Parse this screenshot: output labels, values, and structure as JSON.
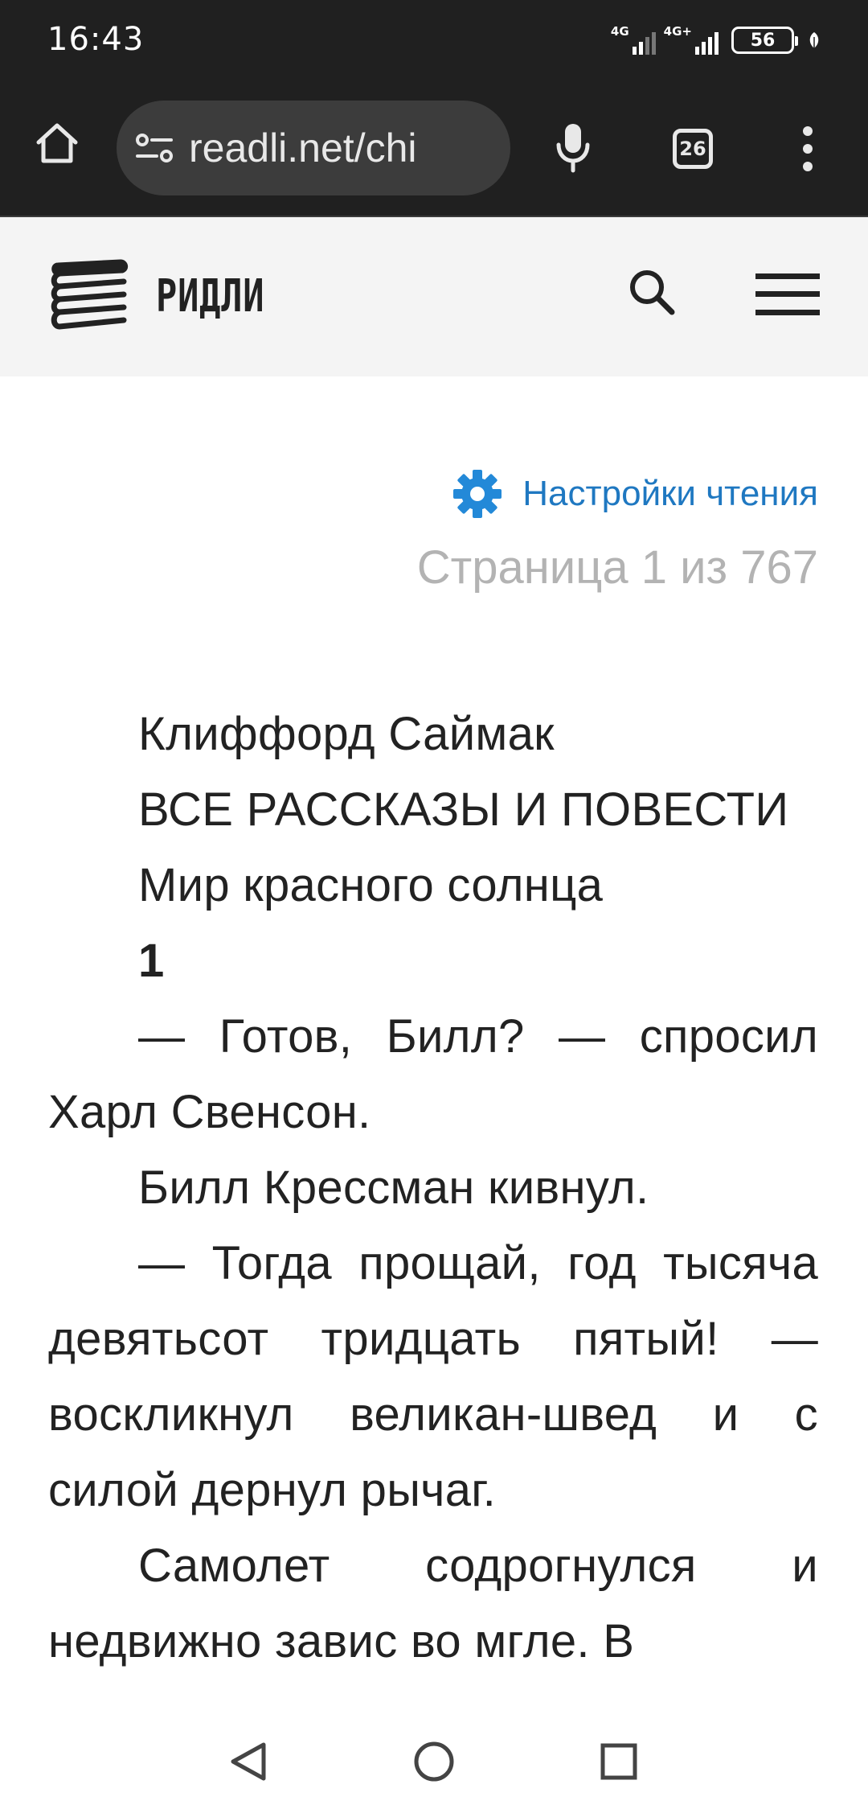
{
  "status_bar": {
    "time": "16:43",
    "network1": "4G",
    "network2": "4G+",
    "battery": "56",
    "icons": [
      "signal-4g-icon",
      "signal-4g-plus-icon",
      "battery-icon",
      "leaf-icon"
    ]
  },
  "browser": {
    "url": "readli.net/chi",
    "tab_count": "26",
    "icons": [
      "home-icon",
      "site-settings-icon",
      "mic-icon",
      "tabs-icon",
      "more-vert-icon"
    ]
  },
  "site": {
    "logo_text": "РИДЛИ",
    "icons": [
      "books-stack-icon",
      "search-icon",
      "hamburger-menu-icon"
    ]
  },
  "reader": {
    "settings_label": "Настройки чтения",
    "page_indicator": "Страница 1 из 767",
    "accent_color": "#1f78c1",
    "paragraphs": [
      "Клиффорд Саймак",
      "ВСЕ РАССКАЗЫ И ПОВЕСТИ",
      "Мир красного солнца",
      "1",
      "— Готов, Билл? — спросил Харл Свенсон.",
      "Билл Крессман кивнул.",
      "— Тогда прощай, год тысяча девятьсот тридцать пятый! — воскликнул великан-швед и с силой дернул рычаг.",
      "Самолет содрогнулся и недвижно завис во мгле. В"
    ]
  },
  "navigation": {
    "icons": [
      "back-triangle-icon",
      "home-circle-icon",
      "recent-apps-square-icon"
    ]
  }
}
